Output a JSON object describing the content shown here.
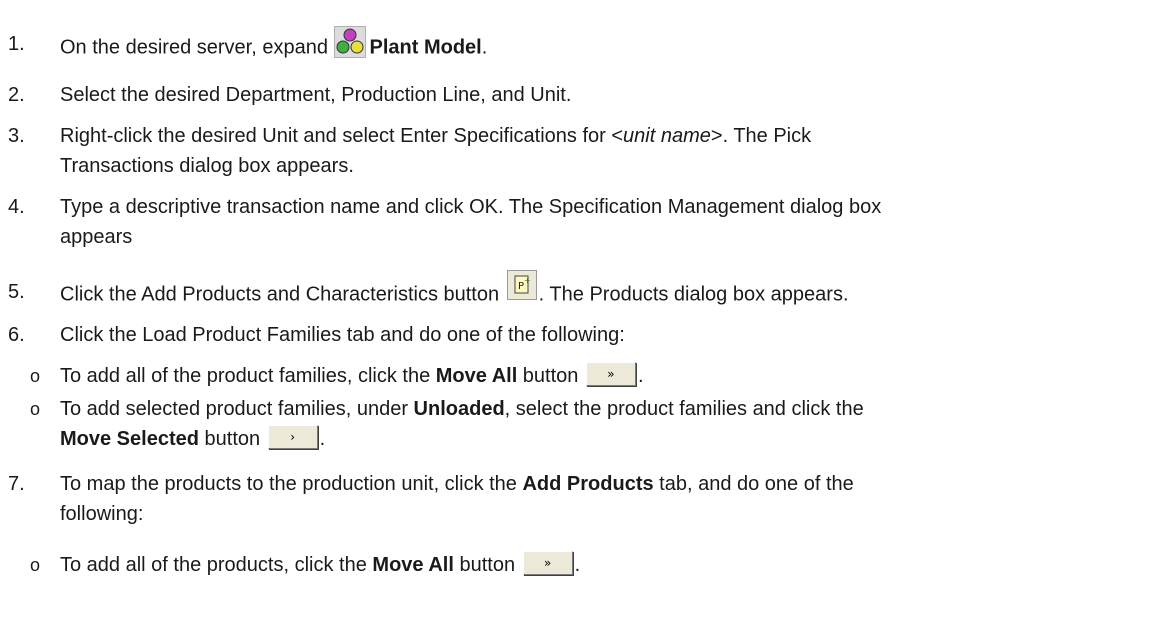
{
  "steps": [
    {
      "num": "1.",
      "pre": "On the desired server, expand ",
      "bold": "Plant Model",
      "post": "."
    },
    {
      "num": "2.",
      "text": "Select the desired Department, Production Line, and Unit."
    },
    {
      "num": "3.",
      "pre": "Right-click the desired Unit and select Enter Specifications for <",
      "italic": "unit name",
      "post": ">. The Pick",
      "cont": "Transactions dialog box appears."
    },
    {
      "num": "4.",
      "text": "Type a descriptive transaction name and click OK. The Specification Management dialog box",
      "cont": "appears"
    },
    {
      "num": "5.",
      "pre": "Click the Add Products and Characteristics button ",
      "post": ". The Products dialog box appears."
    },
    {
      "num": "6.",
      "text": "Click the Load Product Families tab and do one of the following:"
    },
    {
      "num": "7.",
      "pre": "To map the products to the production unit, click the ",
      "bold": "Add Products",
      "post": " tab, and do one of the",
      "cont": "following:"
    }
  ],
  "sub6": [
    {
      "pre": "To add all of the product families, click the ",
      "bold": "Move All",
      "post": " button "
    },
    {
      "pre": "To add selected product families, under ",
      "bold": "Unloaded",
      "post": ", select the product families and click the",
      "cont_bold": "Move Selected",
      "cont_post": " button "
    }
  ],
  "sub7": [
    {
      "pre": "To add all of the products, click the ",
      "bold": "Move All",
      "post": " button "
    }
  ],
  "bullet": "o",
  "buttons": {
    "move_all": "»",
    "move_selected": "›"
  }
}
